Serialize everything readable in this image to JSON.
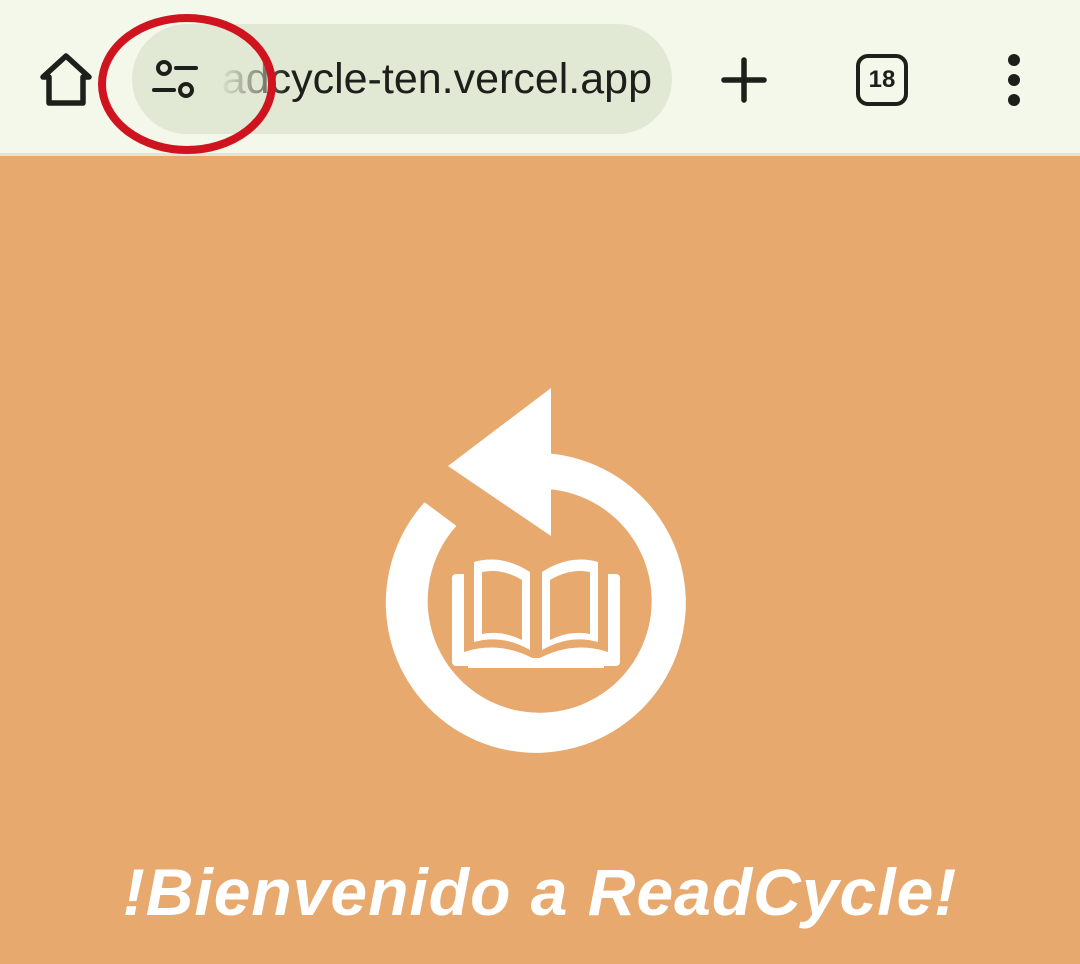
{
  "browser": {
    "url_visible": "readcycle-ten.vercel.app",
    "tab_count": "18",
    "icons": {
      "home": "home-icon",
      "site_settings": "tune-icon",
      "new_tab": "plus-icon",
      "tabs": "tab-switcher-icon",
      "menu": "more-vert-icon"
    },
    "annotation_color": "#d0141f"
  },
  "page": {
    "background_color": "#e8a96e",
    "logo_icon": "readcycle-logo",
    "welcome_text": "!Bienvenido a ReadCycle!"
  }
}
